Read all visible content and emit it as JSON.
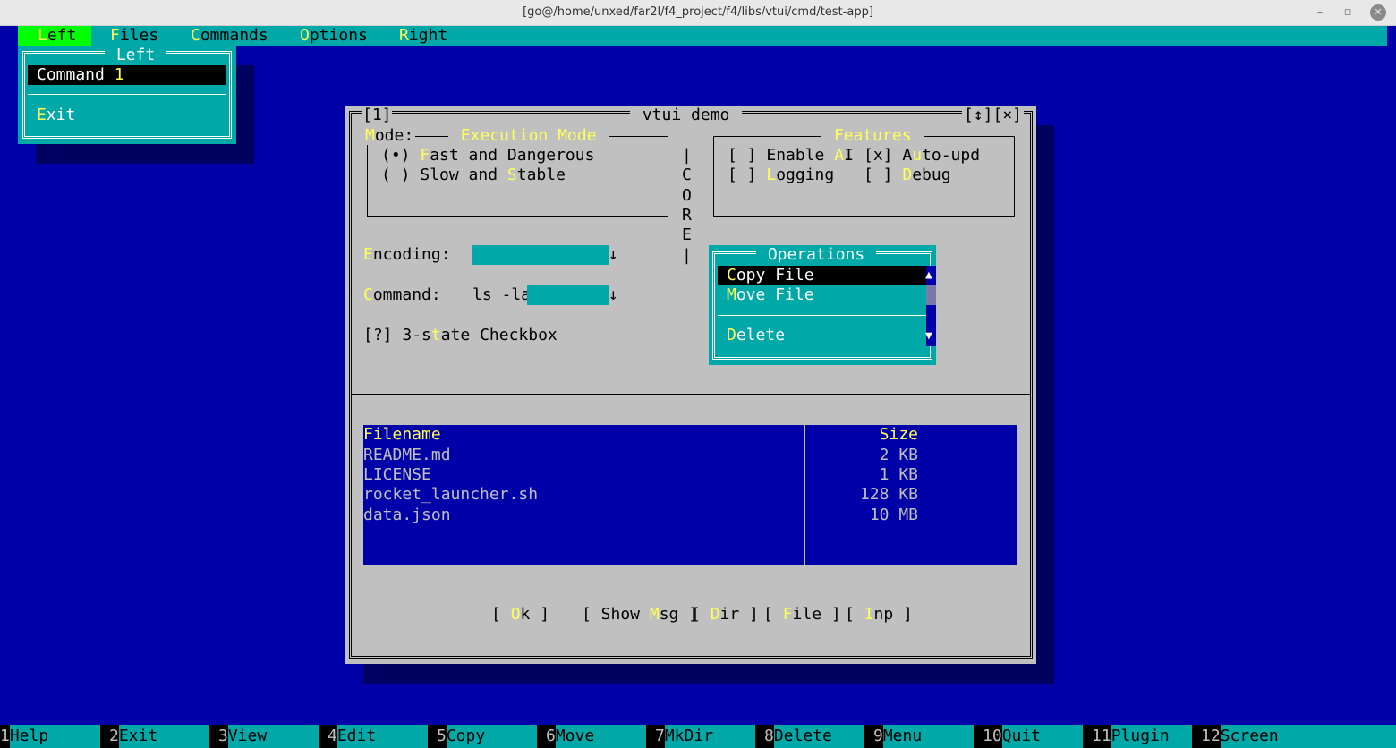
{
  "window": {
    "title": "[go@/home/unxed/far2l/f4_project/f4/libs/vtui/cmd/test-app]",
    "minimize_glyph": "–",
    "maximize_glyph": "▫",
    "close_glyph": "✕"
  },
  "menubar": {
    "items": [
      {
        "hot": "L",
        "rest": "eft"
      },
      {
        "hot": "F",
        "rest": "iles"
      },
      {
        "hot": "C",
        "rest": "ommands"
      },
      {
        "hot": "O",
        "rest": "ptions"
      },
      {
        "hot": "R",
        "rest": "ight"
      }
    ]
  },
  "left_menu": {
    "title": " Left ",
    "items": [
      {
        "text": "Command ",
        "suffix": "1"
      },
      {
        "hot": "E",
        "text": "xit"
      }
    ]
  },
  "dialog": {
    "number": "[1]",
    "title": " vtui demo ",
    "buttons_tr": "[↕][×]",
    "mode": {
      "label_hot": "M",
      "label_rest": "ode:",
      "group_title": " Execution Mode ",
      "options": [
        {
          "mark": "(•) ",
          "hot": "F",
          "rest": "ast and Dangerous"
        },
        {
          "mark": "( ) ",
          "pre": "Slow and ",
          "hot": "S",
          "rest": "table"
        }
      ]
    },
    "core_label": [
      "C",
      "O",
      "R",
      "E"
    ],
    "core_bar": "|",
    "features": {
      "title": " Features ",
      "items": [
        {
          "mark": "[ ] ",
          "pre": "Enable ",
          "hot": "A",
          "rest": "I"
        },
        {
          "mark": "[x] ",
          "pre": "A",
          "hot": "u",
          "rest": "to-upd"
        },
        {
          "mark": "[ ] ",
          "pre": "",
          "hot": "L",
          "rest": "ogging"
        },
        {
          "mark": "[ ] ",
          "pre": "",
          "hot": "D",
          "rest": "ebug"
        }
      ]
    },
    "encoding": {
      "hot": "E",
      "rest": "ncoding:",
      "value": "",
      "arrow": "↓"
    },
    "command": {
      "hot": "C",
      "rest": "ommand:",
      "value": "ls -la",
      "arrow": "↓"
    },
    "tristate": {
      "mark": "[?] ",
      "pre": "3-s",
      "hot": "t",
      "rest": "ate Checkbox"
    },
    "operations": {
      "title": " Operations ",
      "items": [
        {
          "hot": "C",
          "rest": "opy File"
        },
        {
          "hot": "M",
          "rest": "ove File"
        },
        {
          "hot": "D",
          "rest": "elete"
        }
      ],
      "scroll_up": "▲",
      "scroll_down": "▼"
    },
    "table": {
      "columns": [
        "Filename",
        "Size"
      ],
      "rows": [
        {
          "name": "README.md",
          "size": "2 KB"
        },
        {
          "name": "LICENSE",
          "size": "1 KB"
        },
        {
          "name": "rocket_launcher.sh",
          "size": "128 KB"
        },
        {
          "name": "data.json",
          "size": "10 MB"
        }
      ]
    },
    "buttons": {
      "ok": {
        "open": "[ ",
        "hot": "O",
        "rest": "k",
        "close": " ]"
      },
      "msg": {
        "open": "[ Show ",
        "hot": "M",
        "rest": "sg",
        "close": " ]"
      },
      "dir": {
        "open": "[ ",
        "hot": "D",
        "rest": "ir",
        "close": " ]"
      },
      "file": {
        "open": "[ ",
        "hot": "F",
        "rest": "ile",
        "close": " ]"
      },
      "inp": {
        "open": "[ ",
        "hot": "I",
        "rest": "np",
        "close": " ]"
      }
    }
  },
  "keybar": [
    {
      "num": "1",
      "label": "Help"
    },
    {
      "num": "2",
      "label": "Exit"
    },
    {
      "num": "3",
      "label": "View"
    },
    {
      "num": "4",
      "label": "Edit"
    },
    {
      "num": "5",
      "label": "Copy"
    },
    {
      "num": "6",
      "label": "Move"
    },
    {
      "num": "7",
      "label": "MkDir"
    },
    {
      "num": "8",
      "label": "Delete"
    },
    {
      "num": "9",
      "label": "Menu"
    },
    {
      "num": "10",
      "label": "Quit"
    },
    {
      "num": "11",
      "label": "Plugin"
    },
    {
      "num": "12",
      "label": "Screen"
    }
  ],
  "colors": {
    "background": "#0000a8",
    "cyan": "#00a8a8",
    "hotkey": "#ffff55",
    "menu_active": "#00ff00",
    "dialog": "#c0c0c0",
    "selected": "#000000"
  }
}
